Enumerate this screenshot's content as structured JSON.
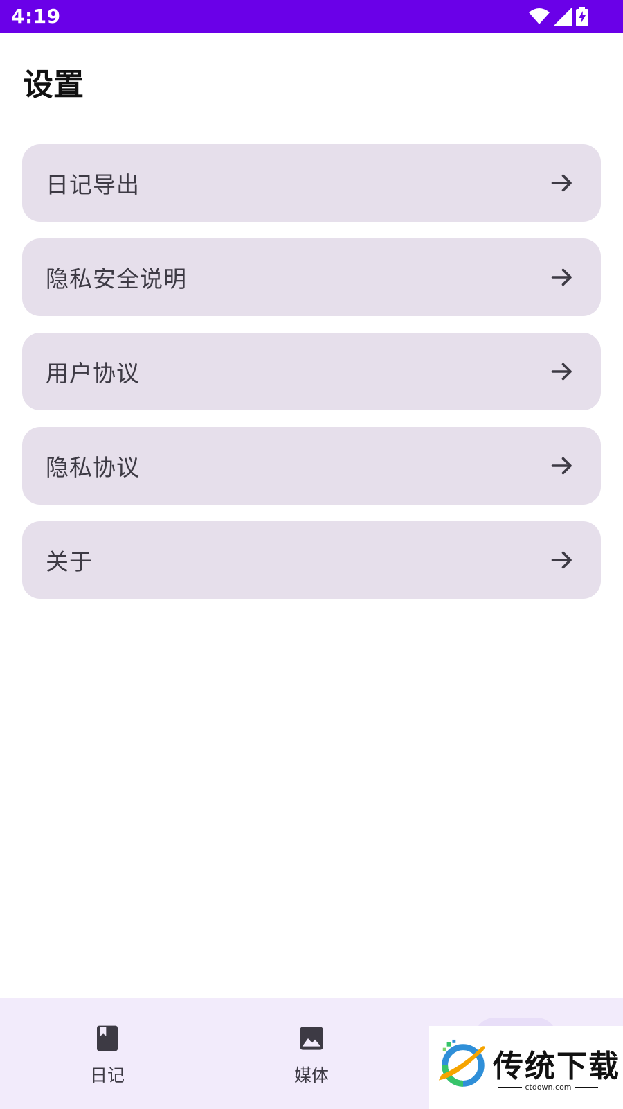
{
  "status_bar": {
    "time": "4:19",
    "icons": [
      "wifi-icon",
      "cell-signal-icon",
      "battery-charging-icon"
    ],
    "color": "#6a00e8"
  },
  "page": {
    "title": "设置"
  },
  "settings": {
    "items": [
      {
        "label": "日记导出",
        "icon": "arrow-right-icon"
      },
      {
        "label": "隐私安全说明",
        "icon": "arrow-right-icon"
      },
      {
        "label": "用户协议",
        "icon": "arrow-right-icon"
      },
      {
        "label": "隐私协议",
        "icon": "arrow-right-icon"
      },
      {
        "label": "关于",
        "icon": "arrow-right-icon"
      }
    ],
    "item_color": "#e6dfeb"
  },
  "bottom_nav": {
    "items": [
      {
        "label": "日记",
        "icon": "book-icon"
      },
      {
        "label": "媒体",
        "icon": "image-icon"
      }
    ],
    "background": "#f2ebfb"
  },
  "watermark": {
    "text": "传统下载",
    "subtext": "ctdown.com"
  }
}
